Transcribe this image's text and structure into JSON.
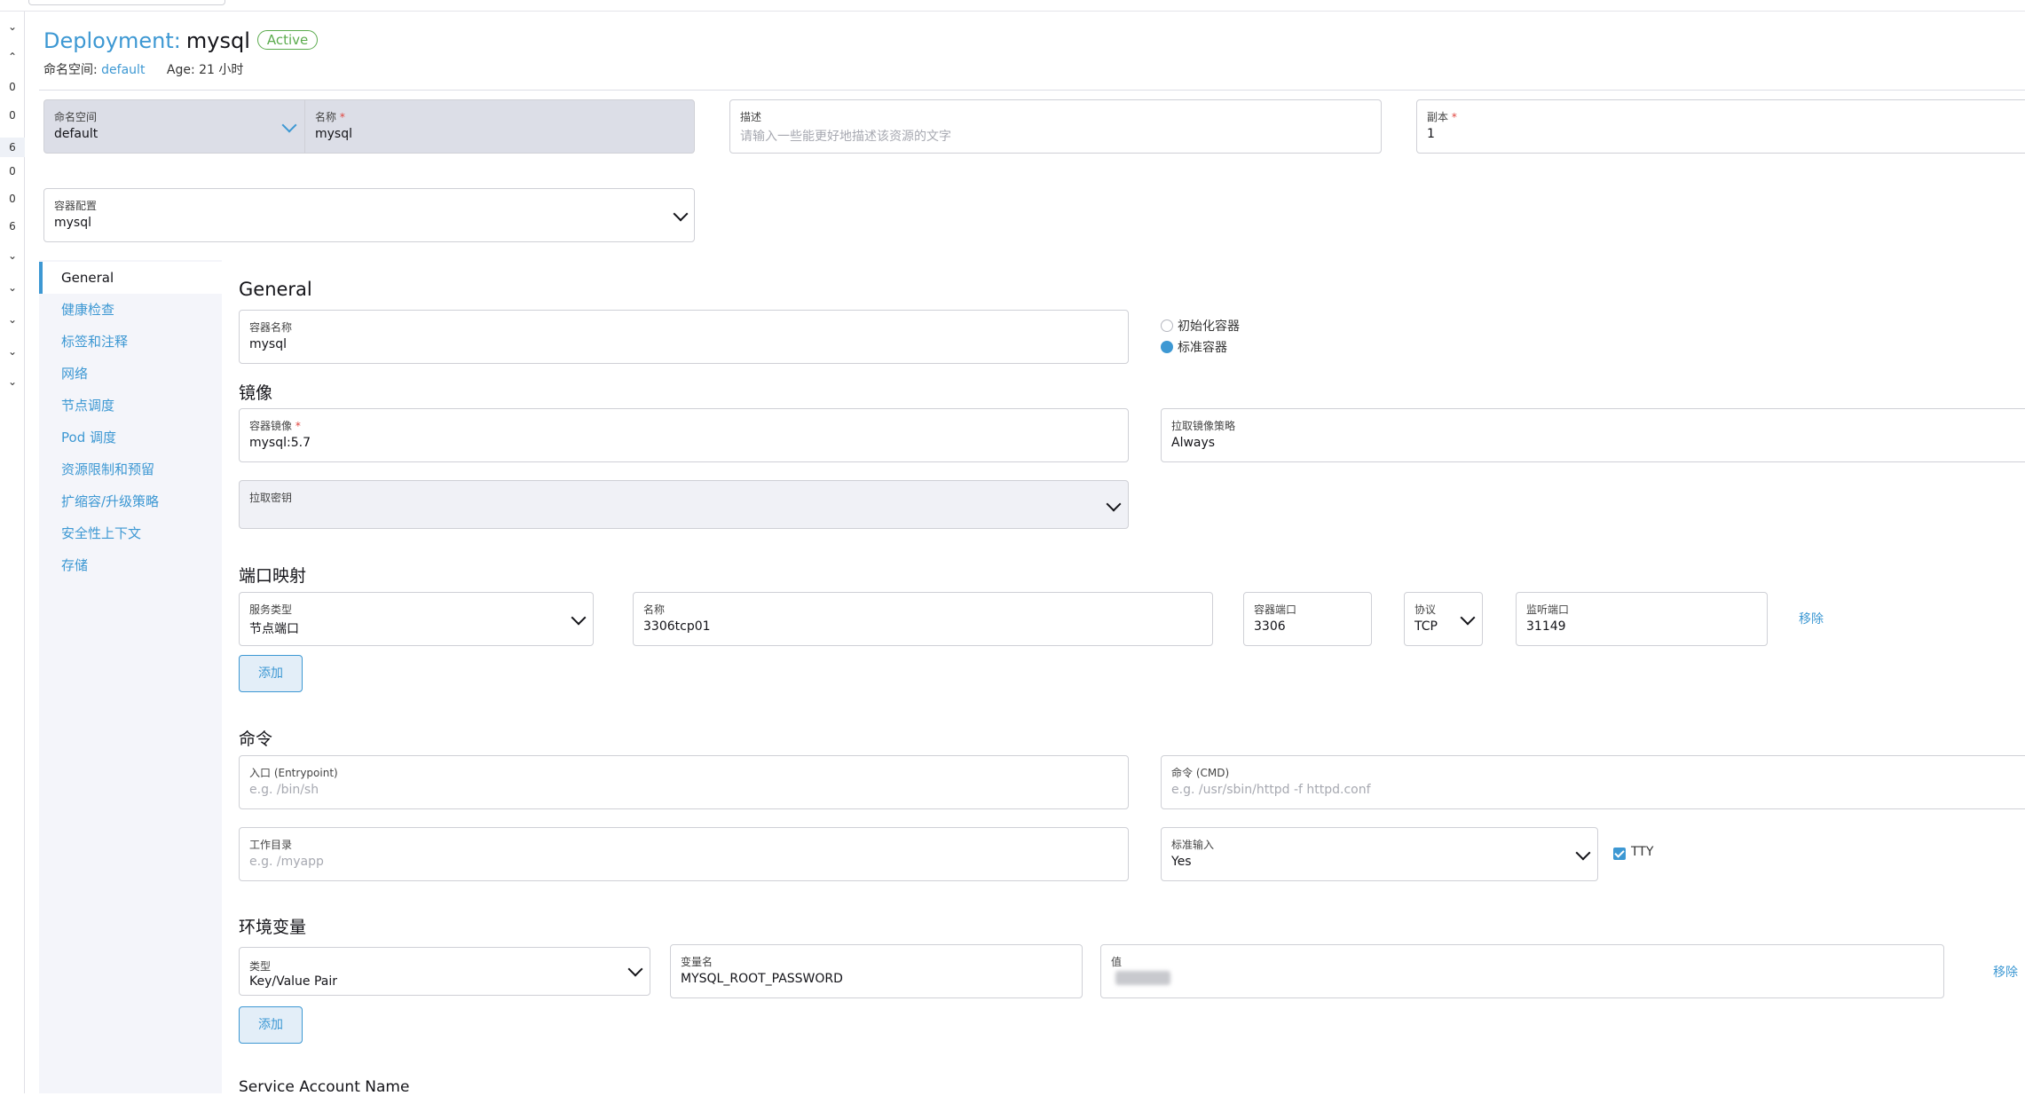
{
  "header": {
    "kind": "Deployment:",
    "name": "mysql",
    "status": "Active",
    "namespace_label": "命名空间:",
    "namespace_value": "default",
    "age_label": "Age:",
    "age_value": "21 小时"
  },
  "rail": [
    "⌄",
    "⌃",
    "0",
    "0",
    "6",
    "0",
    "0",
    "6",
    "⌄",
    "⌄",
    "⌄",
    "⌄",
    "⌄"
  ],
  "meta": {
    "namespace": {
      "label": "命名空间",
      "value": "default"
    },
    "name": {
      "label": "名称",
      "required": "*",
      "value": "mysql"
    },
    "description": {
      "label": "描述",
      "placeholder": "请输入一些能更好地描述该资源的文字"
    },
    "replicas": {
      "label": "副本",
      "required": "*",
      "value": "1"
    },
    "container_config": {
      "label": "容器配置",
      "value": "mysql"
    }
  },
  "tabs": [
    "General",
    "健康检查",
    "标签和注释",
    "网络",
    "节点调度",
    "Pod 调度",
    "资源限制和预留",
    "扩缩容/升级策略",
    "安全性上下文",
    "存储"
  ],
  "general": {
    "title": "General",
    "container_name": {
      "label": "容器名称",
      "value": "mysql"
    },
    "radio_init": "初始化容器",
    "radio_standard": "标准容器"
  },
  "image": {
    "title": "镜像",
    "container_image": {
      "label": "容器镜像",
      "required": "*",
      "value": "mysql:5.7"
    },
    "pull_policy": {
      "label": "拉取镜像策略",
      "value": "Always"
    },
    "pull_secret": {
      "label": "拉取密钥",
      "value": ""
    }
  },
  "ports": {
    "title": "端口映射",
    "service_type": {
      "label": "服务类型",
      "value": "节点端口"
    },
    "name": {
      "label": "名称",
      "value": "3306tcp01"
    },
    "container_port": {
      "label": "容器端口",
      "value": "3306"
    },
    "protocol": {
      "label": "协议",
      "value": "TCP"
    },
    "listen_port": {
      "label": "监听端口",
      "value": "31149"
    },
    "remove": "移除",
    "add": "添加"
  },
  "command": {
    "title": "命令",
    "entrypoint": {
      "label": "入口 (Entrypoint)",
      "placeholder": "e.g. /bin/sh"
    },
    "cmd": {
      "label": "命令 (CMD)",
      "placeholder": "e.g. /usr/sbin/httpd -f httpd.conf"
    },
    "workdir": {
      "label": "工作目录",
      "placeholder": "e.g. /myapp"
    },
    "stdin": {
      "label": "标准输入",
      "value": "Yes"
    },
    "tty": "TTY"
  },
  "env": {
    "title": "环境变量",
    "type": {
      "label": "类型",
      "value": "Key/Value Pair"
    },
    "var_name": {
      "label": "变量名",
      "value": "MYSQL_ROOT_PASSWORD"
    },
    "value": {
      "label": "值",
      "value": ""
    },
    "remove": "移除",
    "add": "添加"
  },
  "service_account": {
    "title": "Service Account Name"
  },
  "colors": {
    "accent": "#3d98d3",
    "active_badge": "#5bab4d",
    "required": "#e0443e",
    "disabled_field": "#dcdee7"
  }
}
